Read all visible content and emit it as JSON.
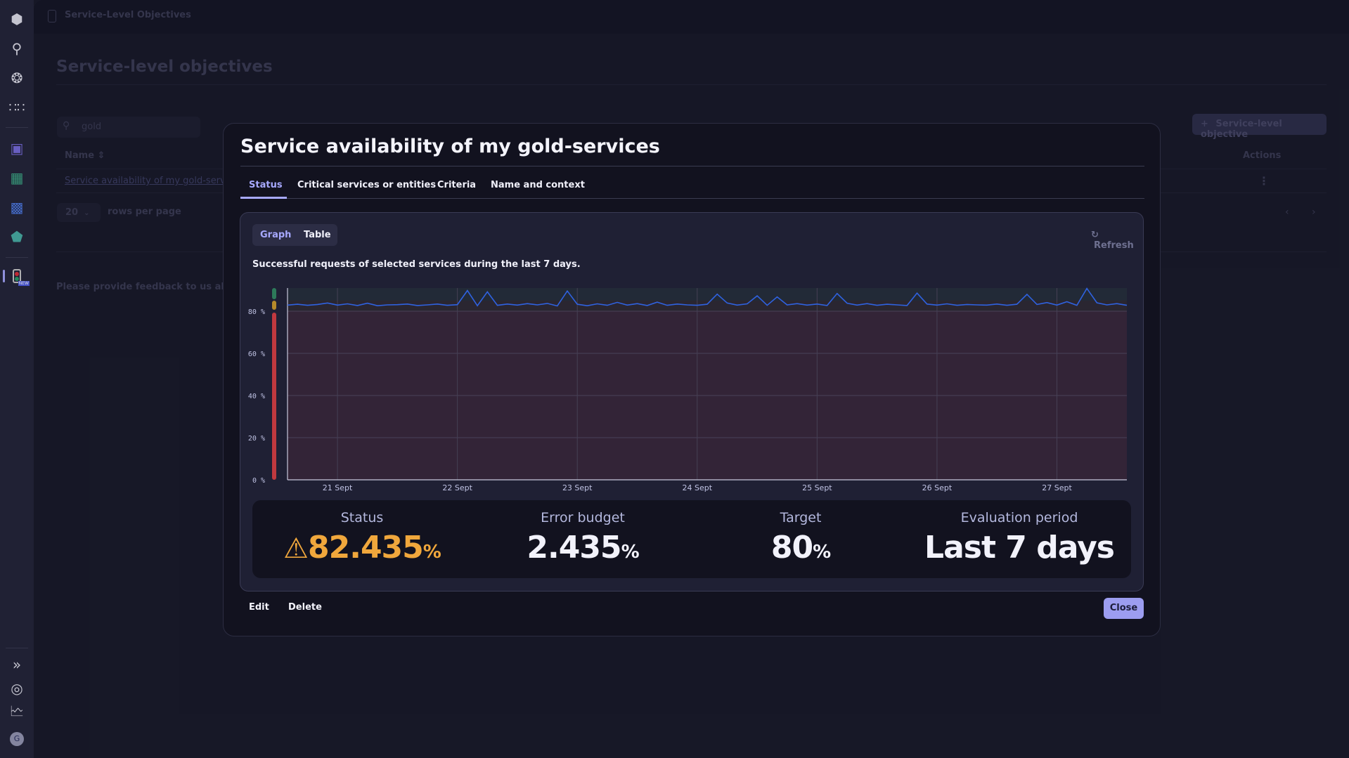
{
  "sidebar": {
    "top_icons": [
      "dynatrace-logo-icon",
      "search-icon",
      "ai-assistant-icon",
      "apps-grid-icon"
    ],
    "app_icons": [
      "infrastructure-icon",
      "dashboards-icon",
      "workflows-icon",
      "security-icon"
    ],
    "active_app_icon": "slo-traffic-light-icon",
    "active_badge": "NEW",
    "bottom_icons": [
      "expand-icon",
      "help-icon",
      "reports-icon"
    ],
    "avatar_initial": "G"
  },
  "page": {
    "breadcrumb": "Service-Level Objectives",
    "title": "Service-level objectives",
    "search_value": "gold",
    "add_button": "Service-level objective",
    "table_headers": {
      "name": "Name",
      "actions": "Actions"
    },
    "rows": [
      {
        "name": "Service availability of my gold-servi"
      }
    ],
    "rows_per_page_value": "20",
    "rows_per_page_label": "rows per page",
    "feedback": "Please provide feedback to us about th"
  },
  "modal": {
    "title": "Service availability of my gold-services",
    "tabs": [
      "Status",
      "Critical services or entities",
      "Criteria",
      "Name and context"
    ],
    "active_tab": "Status",
    "view_toggle": [
      "Graph",
      "Table"
    ],
    "active_view": "Graph",
    "refresh": "Refresh",
    "subtitle": "Successful requests of selected services during the last 7 days.",
    "stats": [
      {
        "label": "Status",
        "value": "82.435",
        "unit": "%",
        "icon": "warning-icon",
        "color": "#f0a73c"
      },
      {
        "label": "Error budget",
        "value": "2.435",
        "unit": "%"
      },
      {
        "label": "Target",
        "value": "80",
        "unit": "%"
      },
      {
        "label": "Evaluation period",
        "value": "Last 7 days",
        "unit": ""
      }
    ],
    "edit": "Edit",
    "delete": "Delete",
    "close": "Close"
  },
  "colors": {
    "accent": "#a7a9ff",
    "line": "#2f62e0",
    "fail_zone": "#332437",
    "warning_zone": "#2a2631",
    "good_zone": "#222a37",
    "status_warning": "#f0a73c",
    "indicator_good": "#2d7a5a",
    "indicator_warning": "#b68a2a",
    "indicator_fail": "#c0393f"
  },
  "chart_data": {
    "type": "line",
    "ylim": [
      0,
      91
    ],
    "yticks": [
      "0 %",
      "20 %",
      "40 %",
      "60 %",
      "80 %"
    ],
    "ytick_values": [
      0,
      20,
      40,
      60,
      80
    ],
    "xticks": [
      "21 Sept",
      "22 Sept",
      "23 Sept",
      "24 Sept",
      "25 Sept",
      "26 Sept",
      "27 Sept"
    ],
    "time_range": [
      "20 Sept 14:00",
      "27 Sept 14:00"
    ],
    "sampling": "2 h",
    "grid": true,
    "target": 80,
    "warning": 85,
    "values": [
      82.9,
      83.3,
      82.8,
      83.2,
      83.9,
      82.9,
      83.5,
      82.7,
      83.8,
      82.6,
      83.0,
      83.1,
      83.4,
      82.7,
      83.0,
      83.4,
      82.8,
      83.1,
      89.8,
      82.6,
      89.2,
      82.8,
      83.4,
      82.9,
      83.6,
      83.0,
      83.7,
      82.5,
      89.6,
      83.3,
      82.6,
      83.5,
      82.8,
      84.2,
      82.9,
      83.6,
      82.7,
      84.3,
      82.8,
      83.4,
      83.0,
      82.8,
      83.3,
      88.1,
      83.9,
      82.9,
      83.5,
      87.3,
      82.8,
      86.8,
      83.0,
      83.6,
      82.9,
      83.4,
      82.7,
      88.4,
      83.8,
      82.9,
      83.6,
      82.8,
      83.3,
      83.0,
      82.7,
      88.6,
      83.4,
      82.9,
      83.5,
      82.8,
      83.2,
      83.0,
      82.9,
      83.4,
      82.8,
      83.3,
      88.0,
      83.2,
      84.1,
      82.9,
      84.5,
      82.8,
      90.8,
      84.0,
      83.0,
      83.6,
      82.8
    ]
  }
}
